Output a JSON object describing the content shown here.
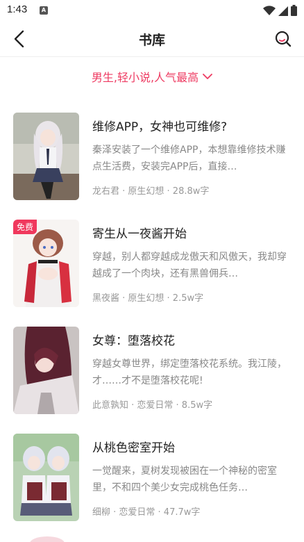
{
  "status_bar": {
    "time": "1:43",
    "app_icon": "A",
    "icons": [
      "wifi-icon",
      "cellular-signal-icon",
      "battery-icon"
    ]
  },
  "header": {
    "title": "书库",
    "back_icon": "chevron-left-icon",
    "search_icon": "search-icon"
  },
  "filter": {
    "label": "男生,轻小说,人气最高",
    "icon": "chevron-down-icon",
    "accent_color": "#ee3b62"
  },
  "books": [
    {
      "title": "维修APP，女神也可维修?",
      "description": "秦泽安装了一个维修APP，本想靠维修技术赚点生活费，安装完APP后，直接…",
      "meta": "龙右君 · 原生幻想 · 28.8w字",
      "badge": ""
    },
    {
      "title": "寄生从一夜酱开始",
      "description": "穿越，别人都穿越成龙傲天和风傲天，我却穿越成了一个肉块，还有黑兽佣兵…",
      "meta": "黑夜酱 · 原生幻想 · 2.5w字",
      "badge": "免费"
    },
    {
      "title": "女尊：堕落校花",
      "description": "穿越女尊世界，绑定堕落校花系统。我江陵，才……才不是堕落校花呢!",
      "meta": "此意孰知 · 恋爱日常 · 8.5w字",
      "badge": ""
    },
    {
      "title": "从桃色密室开始",
      "description": "一觉醒来，夏树发现被困在一个神秘的密室里，不和四个美少女完成桃色任务…",
      "meta": "细柳 · 恋爱日常 · 47.7w字",
      "badge": ""
    }
  ]
}
